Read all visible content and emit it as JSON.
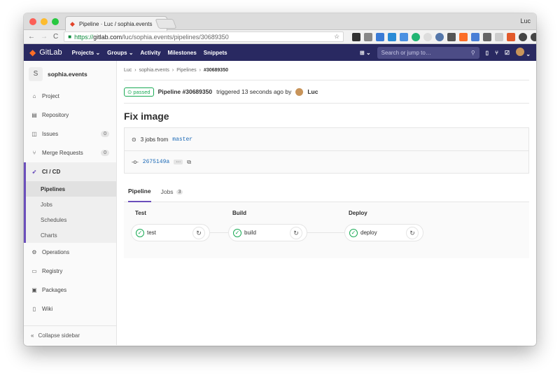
{
  "browser": {
    "tab_title": "Pipeline · Luc / sophia.events",
    "tab_close": "×",
    "profile": "Luc",
    "url_secure": "https://",
    "url_host": "gitlab.com",
    "url_path": "/luc/sophia.events/pipelines/30689350",
    "back_icon": "←",
    "forward_icon": "→",
    "reload_icon": "C"
  },
  "gitlab_nav": {
    "brand": "GitLab",
    "items": [
      "Projects ⌄",
      "Groups ⌄",
      "Activity",
      "Milestones",
      "Snippets"
    ],
    "search_placeholder": "Search or jump to…"
  },
  "sidebar": {
    "project_initial": "S",
    "project_name": "sophia.events",
    "items": [
      {
        "label": "Project",
        "icon": "⌂"
      },
      {
        "label": "Repository",
        "icon": "▤"
      },
      {
        "label": "Issues",
        "icon": "◫",
        "count": "0"
      },
      {
        "label": "Merge Requests",
        "icon": "⑂",
        "count": "0"
      },
      {
        "label": "CI / CD",
        "icon": "🚀"
      }
    ],
    "ci_sub": [
      "Pipelines",
      "Jobs",
      "Schedules",
      "Charts"
    ],
    "items2": [
      {
        "label": "Operations",
        "icon": "⚙"
      },
      {
        "label": "Registry",
        "icon": "▭"
      },
      {
        "label": "Packages",
        "icon": "▣"
      },
      {
        "label": "Wiki",
        "icon": "▯"
      }
    ],
    "collapse": "Collapse sidebar"
  },
  "breadcrumb": {
    "a": "Luc",
    "b": "sophia.events",
    "c": "Pipelines",
    "d": "#30689350"
  },
  "header": {
    "status": "passed",
    "pipeline": "Pipeline #30689350",
    "triggered": "triggered 13 seconds ago by",
    "user": "Luc"
  },
  "commit_title": "Fix image",
  "info": {
    "jobs_text": "3 jobs from",
    "branch": "master",
    "sha": "2675149a",
    "ellipsis": "···"
  },
  "tabs": {
    "pipeline": "Pipeline",
    "jobs": "Jobs",
    "jobs_count": "3"
  },
  "stages": [
    {
      "name": "Test",
      "job": "test"
    },
    {
      "name": "Build",
      "job": "build"
    },
    {
      "name": "Deploy",
      "job": "deploy"
    }
  ],
  "colors": {
    "nav": "#292961",
    "accent": "#6b4fbb",
    "success": "#1aaa55"
  }
}
